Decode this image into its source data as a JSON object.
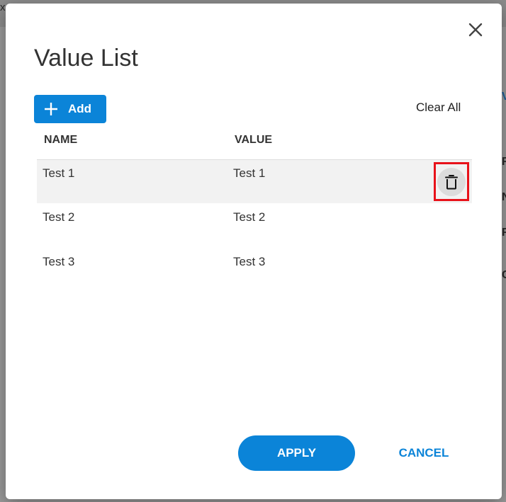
{
  "background": {
    "top_left_char": "x",
    "side_letters": [
      "V",
      "F",
      "N",
      "F",
      "C"
    ]
  },
  "dialog": {
    "title": "Value List",
    "add_label": "Add",
    "clear_all_label": "Clear All",
    "columns": [
      "NAME",
      "VALUE"
    ],
    "rows": [
      {
        "name": "Test 1",
        "value": "Test 1"
      },
      {
        "name": "Test 2",
        "value": "Test 2"
      },
      {
        "name": "Test 3",
        "value": "Test 3"
      }
    ],
    "apply_label": "APPLY",
    "cancel_label": "CANCEL"
  },
  "icons": {
    "close": "close-icon",
    "add": "plus-icon",
    "delete": "trash-icon"
  },
  "colors": {
    "primary": "#0b84d8",
    "highlight": "#e8121a"
  }
}
